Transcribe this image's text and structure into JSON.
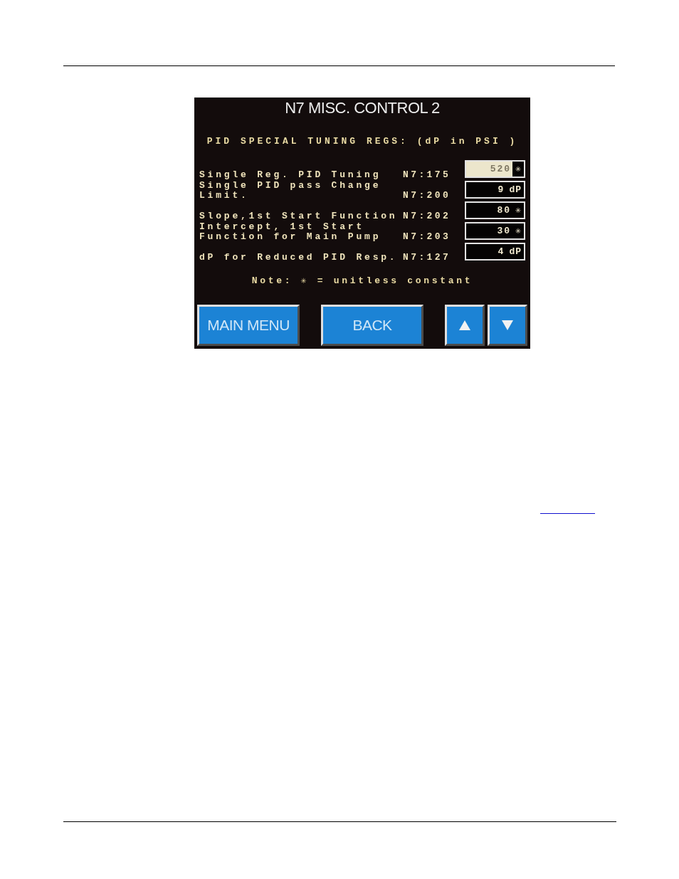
{
  "screen": {
    "title": "N7 MISC. CONTROL 2",
    "subtitle": "PID SPECIAL TUNING REGS: (dP in PSI )",
    "registers": [
      {
        "label": "Single Reg. PID Tuning",
        "address": "N7:175",
        "value": "520",
        "unit": "✳",
        "focused": true
      },
      {
        "label": "Single PID pass Change Limit.",
        "address": "N7:200",
        "value": "9",
        "unit": "dP",
        "focused": false
      },
      {
        "label": "Slope,1st Start Function",
        "address": "N7:202",
        "value": "80",
        "unit": "✳",
        "focused": false
      },
      {
        "label": "Intercept, 1st Start Function for Main Pump",
        "address": "N7:203",
        "value": "30",
        "unit": "✳",
        "focused": false
      },
      {
        "label": "dP for Reduced PID Resp.",
        "address": "N7:127",
        "value": "4",
        "unit": "dP",
        "focused": false
      }
    ],
    "note": "Note: ✳ = unitless constant",
    "buttons": [
      {
        "kind": "text",
        "label": "MAIN MENU"
      },
      {
        "kind": "text",
        "label": "BACK"
      },
      {
        "kind": "up"
      },
      {
        "kind": "down"
      }
    ]
  }
}
